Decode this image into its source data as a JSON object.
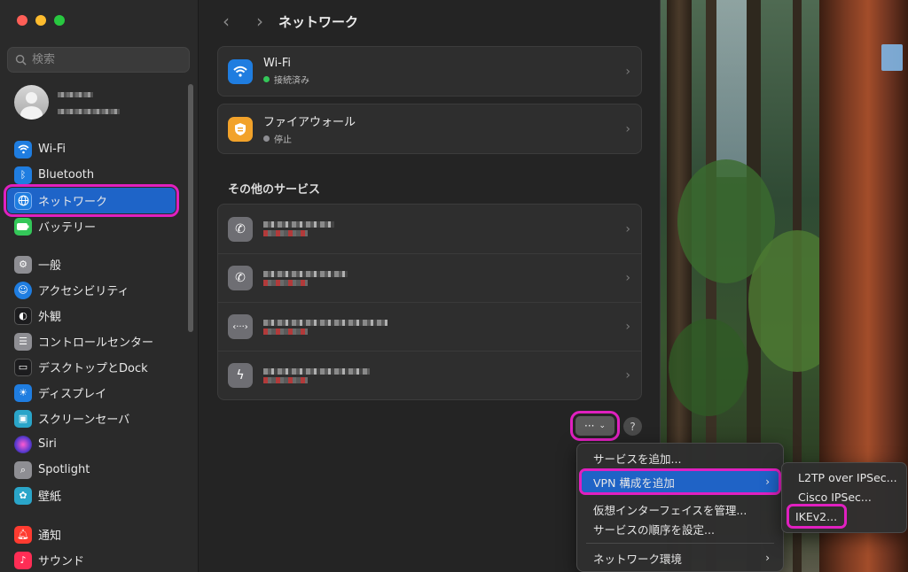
{
  "window": {
    "title": "ネットワーク"
  },
  "search": {
    "placeholder": "検索"
  },
  "sidebar": {
    "items": [
      {
        "label": "Wi-Fi",
        "icon": "wifi-icon",
        "color": "#1f7de0"
      },
      {
        "label": "Bluetooth",
        "icon": "bluetooth-icon",
        "color": "#1f7de0"
      },
      {
        "label": "ネットワーク",
        "icon": "globe-icon",
        "color": "#1f7de0",
        "active": true
      },
      {
        "label": "バッテリー",
        "icon": "battery-icon",
        "color": "#34c759"
      },
      {
        "label": "一般",
        "icon": "gear-icon",
        "color": "#8e8e93"
      },
      {
        "label": "アクセシビリティ",
        "icon": "accessibility-icon",
        "color": "#1f7de0"
      },
      {
        "label": "外観",
        "icon": "appearance-icon",
        "color": "#1c1c1e"
      },
      {
        "label": "コントロールセンター",
        "icon": "control-center-icon",
        "color": "#8e8e93"
      },
      {
        "label": "デスクトップとDock",
        "icon": "desktop-dock-icon",
        "color": "#1c1c1e"
      },
      {
        "label": "ディスプレイ",
        "icon": "display-icon",
        "color": "#1f7de0"
      },
      {
        "label": "スクリーンセーバ",
        "icon": "screensaver-icon",
        "color": "#2aa5c9"
      },
      {
        "label": "Siri",
        "icon": "siri-icon",
        "color": "#b03ad1"
      },
      {
        "label": "Spotlight",
        "icon": "spotlight-icon",
        "color": "#8e8e93"
      },
      {
        "label": "壁紙",
        "icon": "wallpaper-icon",
        "color": "#2aa5c9"
      },
      {
        "label": "通知",
        "icon": "notifications-icon",
        "color": "#ff3b30"
      },
      {
        "label": "サウンド",
        "icon": "sound-icon",
        "color": "#ff2d55"
      }
    ]
  },
  "services": {
    "wifi": {
      "title": "Wi-Fi",
      "status": "接続済み",
      "status_color": "#34c759"
    },
    "firewall": {
      "title": "ファイアウォール",
      "status": "停止",
      "status_color": "#8e8e93"
    }
  },
  "other_services": {
    "heading": "その他のサービス",
    "rows": [
      {
        "icon": "phone-icon"
      },
      {
        "icon": "phone-icon"
      },
      {
        "icon": "vpn-icon"
      },
      {
        "icon": "thunderbolt-icon"
      }
    ]
  },
  "buttons": {
    "more": "···",
    "help": "?"
  },
  "menu": {
    "items": [
      {
        "label": "サービスを追加..."
      },
      {
        "label": "VPN 構成を追加",
        "submenu": true
      },
      {
        "label": "仮想インターフェイスを管理..."
      },
      {
        "label": "サービスの順序を設定..."
      },
      {
        "label": "ネットワーク環境",
        "submenu": true
      }
    ]
  },
  "submenu": {
    "items": [
      {
        "label": "L2TP over IPSec..."
      },
      {
        "label": "Cisco IPSec..."
      },
      {
        "label": "IKEv2..."
      }
    ]
  }
}
